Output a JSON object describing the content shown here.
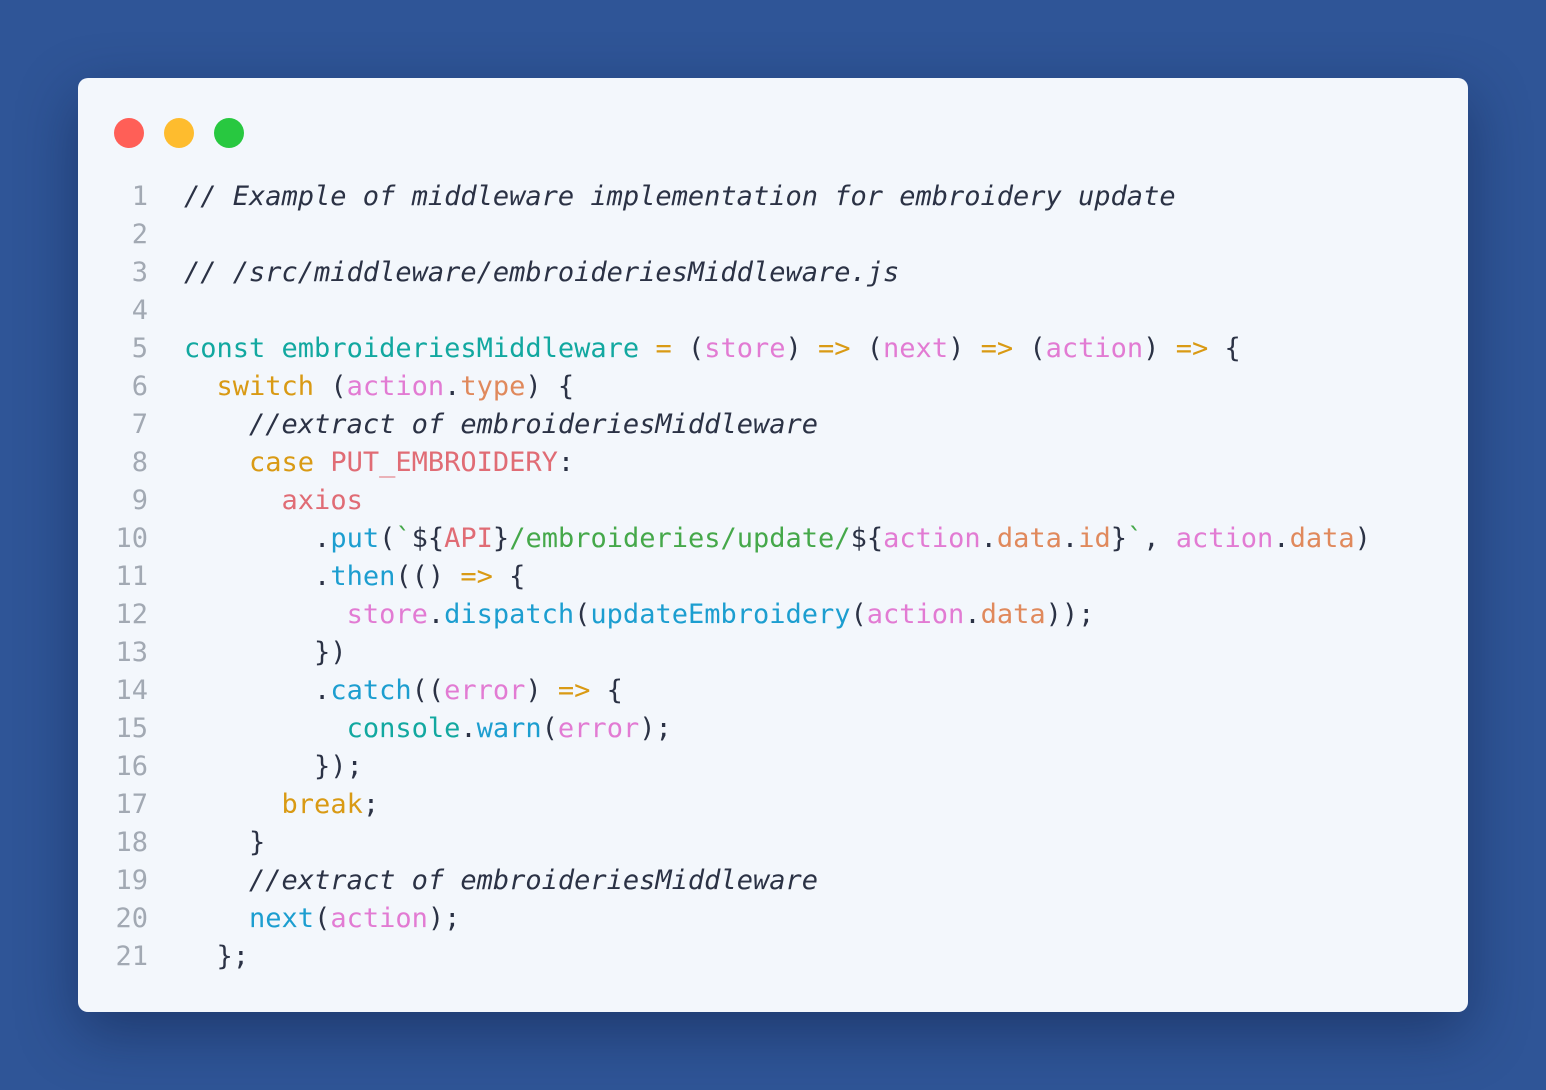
{
  "window": {
    "buttons": [
      {
        "name": "close",
        "color": "#ff5f57"
      },
      {
        "name": "minimize",
        "color": "#febc2e"
      },
      {
        "name": "maximize",
        "color": "#28c840"
      }
    ]
  },
  "colors": {
    "background": "#2f5597",
    "panel": "#f3f7fc",
    "comment": "#2b3245",
    "keyword": "#d99a14",
    "definition": "#12a8a0",
    "parameter": "#e27bd3",
    "property": "#e0895c",
    "constant": "#e06c75",
    "function": "#1c9ed0",
    "string": "#45a84a",
    "line_number": "#a2a9b3"
  },
  "code": {
    "lines": [
      {
        "n": "1",
        "tokens": [
          {
            "t": "// Example of middleware implementation for embroidery update",
            "c": "com"
          }
        ]
      },
      {
        "n": "2",
        "tokens": []
      },
      {
        "n": "3",
        "tokens": [
          {
            "t": "// /src/middleware/embroideriesMiddleware.js",
            "c": "com"
          }
        ]
      },
      {
        "n": "4",
        "tokens": []
      },
      {
        "n": "5",
        "tokens": [
          {
            "t": "const",
            "c": "def"
          },
          {
            "t": " ",
            "c": "pun"
          },
          {
            "t": "embroideriesMiddleware",
            "c": "def"
          },
          {
            "t": " ",
            "c": "pun"
          },
          {
            "t": "=",
            "c": "op"
          },
          {
            "t": " (",
            "c": "pun"
          },
          {
            "t": "store",
            "c": "param"
          },
          {
            "t": ") ",
            "c": "pun"
          },
          {
            "t": "=>",
            "c": "op"
          },
          {
            "t": " (",
            "c": "pun"
          },
          {
            "t": "next",
            "c": "param"
          },
          {
            "t": ") ",
            "c": "pun"
          },
          {
            "t": "=>",
            "c": "op"
          },
          {
            "t": " (",
            "c": "pun"
          },
          {
            "t": "action",
            "c": "param"
          },
          {
            "t": ") ",
            "c": "pun"
          },
          {
            "t": "=>",
            "c": "op"
          },
          {
            "t": " {",
            "c": "pun"
          }
        ]
      },
      {
        "n": "6",
        "tokens": [
          {
            "t": "  ",
            "c": "pun"
          },
          {
            "t": "switch",
            "c": "ctl"
          },
          {
            "t": " (",
            "c": "pun"
          },
          {
            "t": "action",
            "c": "param"
          },
          {
            "t": ".",
            "c": "pun"
          },
          {
            "t": "type",
            "c": "prop"
          },
          {
            "t": ") {",
            "c": "pun"
          }
        ]
      },
      {
        "n": "7",
        "tokens": [
          {
            "t": "    ",
            "c": "pun"
          },
          {
            "t": "//extract of embroideriesMiddleware",
            "c": "com"
          }
        ]
      },
      {
        "n": "8",
        "tokens": [
          {
            "t": "    ",
            "c": "pun"
          },
          {
            "t": "case",
            "c": "ctl"
          },
          {
            "t": " ",
            "c": "pun"
          },
          {
            "t": "PUT_EMBROIDERY",
            "c": "const"
          },
          {
            "t": ":",
            "c": "pun"
          }
        ]
      },
      {
        "n": "9",
        "tokens": [
          {
            "t": "      ",
            "c": "pun"
          },
          {
            "t": "axios",
            "c": "const"
          }
        ]
      },
      {
        "n": "10",
        "tokens": [
          {
            "t": "        .",
            "c": "pun"
          },
          {
            "t": "put",
            "c": "fn"
          },
          {
            "t": "(",
            "c": "pun"
          },
          {
            "t": "`",
            "c": "str"
          },
          {
            "t": "${",
            "c": "pun"
          },
          {
            "t": "API",
            "c": "const"
          },
          {
            "t": "}",
            "c": "pun"
          },
          {
            "t": "/embroideries/update/",
            "c": "str"
          },
          {
            "t": "${",
            "c": "pun"
          },
          {
            "t": "action",
            "c": "param"
          },
          {
            "t": ".",
            "c": "pun"
          },
          {
            "t": "data",
            "c": "prop"
          },
          {
            "t": ".",
            "c": "pun"
          },
          {
            "t": "id",
            "c": "prop"
          },
          {
            "t": "}",
            "c": "pun"
          },
          {
            "t": "`",
            "c": "str"
          },
          {
            "t": ", ",
            "c": "pun"
          },
          {
            "t": "action",
            "c": "param"
          },
          {
            "t": ".",
            "c": "pun"
          },
          {
            "t": "data",
            "c": "prop"
          },
          {
            "t": ")",
            "c": "pun"
          }
        ]
      },
      {
        "n": "11",
        "tokens": [
          {
            "t": "        .",
            "c": "pun"
          },
          {
            "t": "then",
            "c": "fn"
          },
          {
            "t": "(() ",
            "c": "pun"
          },
          {
            "t": "=>",
            "c": "op"
          },
          {
            "t": " {",
            "c": "pun"
          }
        ]
      },
      {
        "n": "12",
        "tokens": [
          {
            "t": "          ",
            "c": "pun"
          },
          {
            "t": "store",
            "c": "param"
          },
          {
            "t": ".",
            "c": "pun"
          },
          {
            "t": "dispatch",
            "c": "fn"
          },
          {
            "t": "(",
            "c": "pun"
          },
          {
            "t": "updateEmbroidery",
            "c": "fn"
          },
          {
            "t": "(",
            "c": "pun"
          },
          {
            "t": "action",
            "c": "param"
          },
          {
            "t": ".",
            "c": "pun"
          },
          {
            "t": "data",
            "c": "prop"
          },
          {
            "t": "));",
            "c": "pun"
          }
        ]
      },
      {
        "n": "13",
        "tokens": [
          {
            "t": "        })",
            "c": "pun"
          }
        ]
      },
      {
        "n": "14",
        "tokens": [
          {
            "t": "        .",
            "c": "pun"
          },
          {
            "t": "catch",
            "c": "fn"
          },
          {
            "t": "((",
            "c": "pun"
          },
          {
            "t": "error",
            "c": "param"
          },
          {
            "t": ") ",
            "c": "pun"
          },
          {
            "t": "=>",
            "c": "op"
          },
          {
            "t": " {",
            "c": "pun"
          }
        ]
      },
      {
        "n": "15",
        "tokens": [
          {
            "t": "          ",
            "c": "pun"
          },
          {
            "t": "console",
            "c": "def"
          },
          {
            "t": ".",
            "c": "pun"
          },
          {
            "t": "warn",
            "c": "fn"
          },
          {
            "t": "(",
            "c": "pun"
          },
          {
            "t": "error",
            "c": "param"
          },
          {
            "t": ");",
            "c": "pun"
          }
        ]
      },
      {
        "n": "16",
        "tokens": [
          {
            "t": "        });",
            "c": "pun"
          }
        ]
      },
      {
        "n": "17",
        "tokens": [
          {
            "t": "      ",
            "c": "pun"
          },
          {
            "t": "break",
            "c": "ctl"
          },
          {
            "t": ";",
            "c": "pun"
          }
        ]
      },
      {
        "n": "18",
        "tokens": [
          {
            "t": "    }",
            "c": "pun"
          }
        ]
      },
      {
        "n": "19",
        "tokens": [
          {
            "t": "    ",
            "c": "pun"
          },
          {
            "t": "//extract of embroideriesMiddleware",
            "c": "com"
          }
        ]
      },
      {
        "n": "20",
        "tokens": [
          {
            "t": "    ",
            "c": "pun"
          },
          {
            "t": "next",
            "c": "fn"
          },
          {
            "t": "(",
            "c": "pun"
          },
          {
            "t": "action",
            "c": "param"
          },
          {
            "t": ");",
            "c": "pun"
          }
        ]
      },
      {
        "n": "21",
        "tokens": [
          {
            "t": "  };",
            "c": "pun"
          }
        ]
      }
    ]
  }
}
